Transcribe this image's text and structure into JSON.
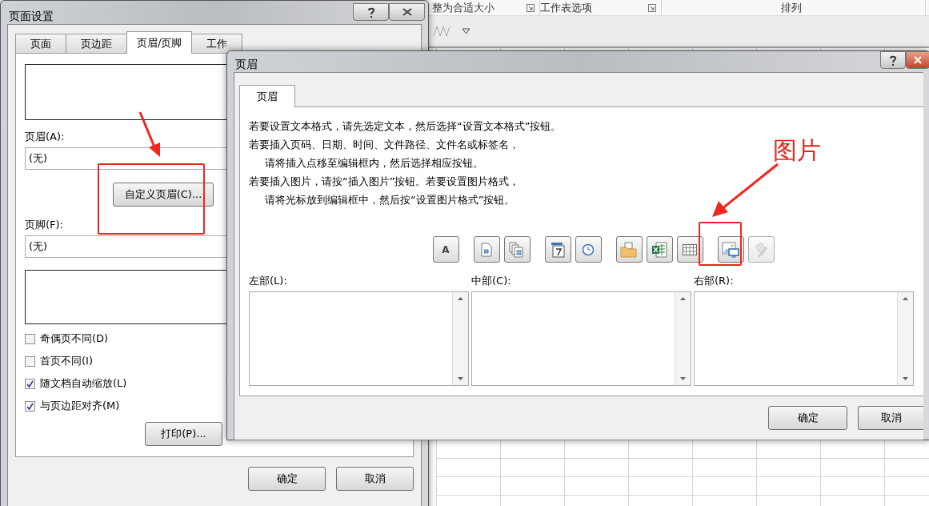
{
  "excel": {
    "ribbon_groups": [
      {
        "label": "整为合适大小",
        "launcher": true
      },
      {
        "label": "工作表选项",
        "launcher": true
      },
      {
        "label": "排列",
        "launcher": false
      }
    ]
  },
  "page_setup": {
    "title": "页面设置",
    "tabs": [
      {
        "label": "页面",
        "selected": false
      },
      {
        "label": "页边距",
        "selected": false
      },
      {
        "label": "页眉/页脚",
        "selected": true
      },
      {
        "label": "工作",
        "selected": false
      }
    ],
    "header_label": "页眉(A):",
    "header_value": "(无)",
    "custom_header_button": "自定义页眉(C)...",
    "footer_label": "页脚(F):",
    "footer_value": "(无)",
    "checkboxes": [
      {
        "label": "奇偶页不同(D)",
        "checked": false
      },
      {
        "label": "首页不同(I)",
        "checked": false
      },
      {
        "label": "随文档自动缩放(L)",
        "checked": true
      },
      {
        "label": "与页边距对齐(M)",
        "checked": true
      }
    ],
    "print_button": "打印(P)...",
    "ok_button": "确定",
    "cancel_button": "取消"
  },
  "header_dialog": {
    "title": "页眉",
    "tab": "页眉",
    "instructions": [
      {
        "lines": [
          "若要设置文本格式，请先选定文本，然后选择“设置文本格式”按钮。"
        ]
      },
      {
        "lines": [
          "若要插入页码、日期、时间、文件路径、文件名或标签名，",
          "请将插入点移至编辑框内，然后选择相应按钮。"
        ]
      },
      {
        "lines": [
          "若要插入图片，请按“插入图片”按钮。若要设置图片格式，",
          "请将光标放到编辑框中，然后按“设置图片格式”按钮。"
        ]
      }
    ],
    "toolbar": [
      {
        "kind": "text",
        "label": "A",
        "disabled": false,
        "group_start": true
      },
      {
        "kind": "page",
        "disabled": false,
        "group_start": true
      },
      {
        "kind": "pages",
        "disabled": false,
        "group_start": false
      },
      {
        "kind": "date",
        "disabled": false,
        "group_start": true
      },
      {
        "kind": "time",
        "disabled": false,
        "group_start": false
      },
      {
        "kind": "folder",
        "disabled": false,
        "group_start": true
      },
      {
        "kind": "sheet",
        "disabled": false,
        "group_start": false
      },
      {
        "kind": "grid",
        "disabled": false,
        "group_start": false
      },
      {
        "kind": "picture",
        "disabled": false,
        "group_start": true
      },
      {
        "kind": "format",
        "disabled": true,
        "group_start": false
      }
    ],
    "sections": [
      {
        "label": "左部(L):"
      },
      {
        "label": "中部(C):"
      },
      {
        "label": "右部(R):"
      }
    ],
    "ok_button": "确定",
    "cancel_button": "取消"
  },
  "annotation": {
    "label": "图片"
  }
}
